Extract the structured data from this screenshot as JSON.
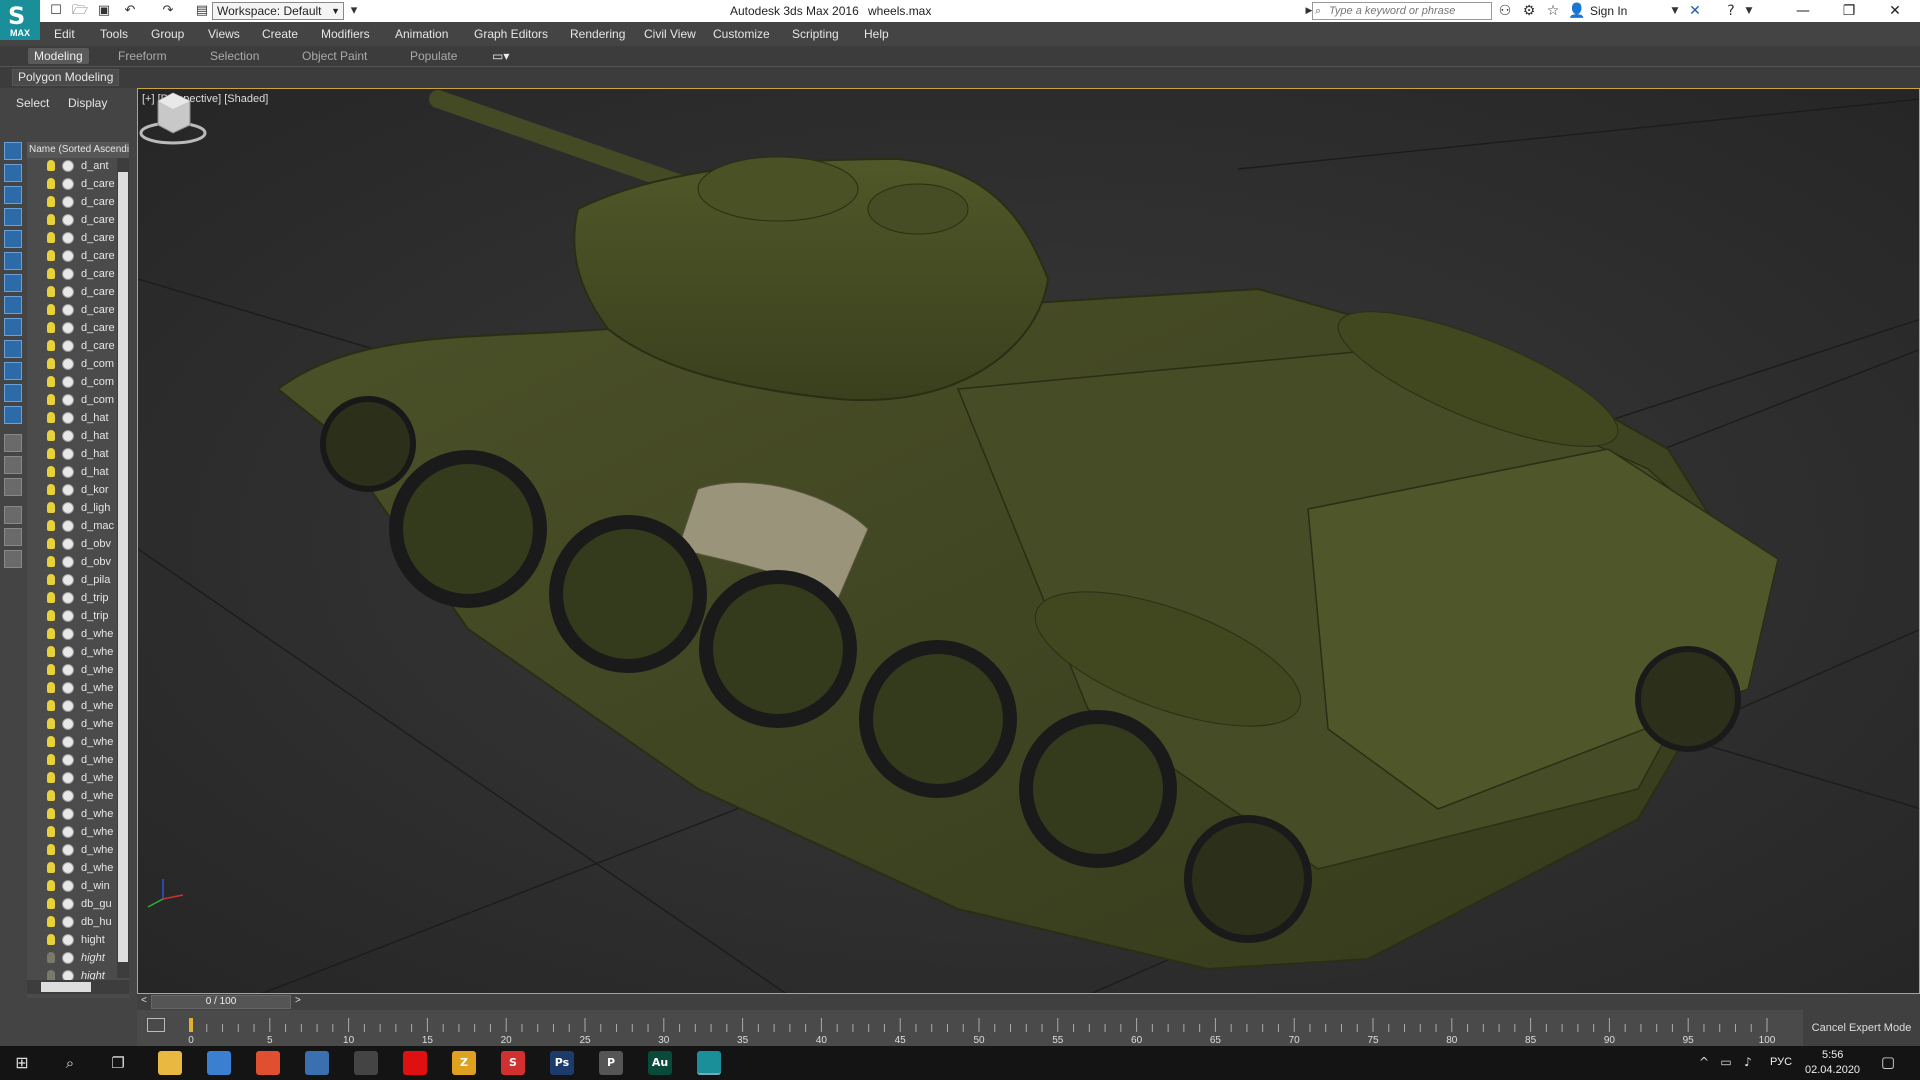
{
  "titlebar": {
    "app_badge": "MAX",
    "workspace": "Workspace: Default",
    "app_title": "Autodesk 3ds Max 2016",
    "file_name": "wheels.max",
    "search_placeholder": "Type a keyword or phrase",
    "sign_in": "Sign In"
  },
  "menu": [
    "Edit",
    "Tools",
    "Group",
    "Views",
    "Create",
    "Modifiers",
    "Animation",
    "Graph Editors",
    "Rendering",
    "Civil View",
    "Customize",
    "Scripting",
    "Help"
  ],
  "ribbon": {
    "tabs": [
      "Modeling",
      "Freeform",
      "Selection",
      "Object Paint",
      "Populate"
    ],
    "active_tab": "Modeling",
    "panel_label": "Polygon Modeling"
  },
  "scene_explorer": {
    "tabs": [
      "Select",
      "Display"
    ],
    "column_header": "Name (Sorted Ascending)",
    "items": [
      {
        "name": "d_ant",
        "on": true,
        "italic": false
      },
      {
        "name": "d_care",
        "on": true,
        "italic": false
      },
      {
        "name": "d_care",
        "on": true,
        "italic": false
      },
      {
        "name": "d_care",
        "on": true,
        "italic": false
      },
      {
        "name": "d_care",
        "on": true,
        "italic": false
      },
      {
        "name": "d_care",
        "on": true,
        "italic": false
      },
      {
        "name": "d_care",
        "on": true,
        "italic": false
      },
      {
        "name": "d_care",
        "on": true,
        "italic": false
      },
      {
        "name": "d_care",
        "on": true,
        "italic": false
      },
      {
        "name": "d_care",
        "on": true,
        "italic": false
      },
      {
        "name": "d_care",
        "on": true,
        "italic": false
      },
      {
        "name": "d_com",
        "on": true,
        "italic": false
      },
      {
        "name": "d_com",
        "on": true,
        "italic": false
      },
      {
        "name": "d_com",
        "on": true,
        "italic": false
      },
      {
        "name": "d_hat",
        "on": true,
        "italic": false
      },
      {
        "name": "d_hat",
        "on": true,
        "italic": false
      },
      {
        "name": "d_hat",
        "on": true,
        "italic": false
      },
      {
        "name": "d_hat",
        "on": true,
        "italic": false
      },
      {
        "name": "d_kor",
        "on": true,
        "italic": false
      },
      {
        "name": "d_ligh",
        "on": true,
        "italic": false
      },
      {
        "name": "d_mac",
        "on": true,
        "italic": false
      },
      {
        "name": "d_obv",
        "on": true,
        "italic": false
      },
      {
        "name": "d_obv",
        "on": true,
        "italic": false
      },
      {
        "name": "d_pila",
        "on": true,
        "italic": false
      },
      {
        "name": "d_trip",
        "on": true,
        "italic": false
      },
      {
        "name": "d_trip",
        "on": true,
        "italic": false
      },
      {
        "name": "d_whe",
        "on": true,
        "italic": false
      },
      {
        "name": "d_whe",
        "on": true,
        "italic": false
      },
      {
        "name": "d_whe",
        "on": true,
        "italic": false
      },
      {
        "name": "d_whe",
        "on": true,
        "italic": false
      },
      {
        "name": "d_whe",
        "on": true,
        "italic": false
      },
      {
        "name": "d_whe",
        "on": true,
        "italic": false
      },
      {
        "name": "d_whe",
        "on": true,
        "italic": false
      },
      {
        "name": "d_whe",
        "on": true,
        "italic": false
      },
      {
        "name": "d_whe",
        "on": true,
        "italic": false
      },
      {
        "name": "d_whe",
        "on": true,
        "italic": false
      },
      {
        "name": "d_whe",
        "on": true,
        "italic": false
      },
      {
        "name": "d_whe",
        "on": true,
        "italic": false
      },
      {
        "name": "d_whe",
        "on": true,
        "italic": false
      },
      {
        "name": "d_whe",
        "on": true,
        "italic": false
      },
      {
        "name": "d_win",
        "on": true,
        "italic": false
      },
      {
        "name": "db_gu",
        "on": true,
        "italic": false
      },
      {
        "name": "db_hu",
        "on": true,
        "italic": false
      },
      {
        "name": "hight",
        "on": true,
        "italic": false
      },
      {
        "name": "hight",
        "on": false,
        "italic": true
      },
      {
        "name": "hight",
        "on": false,
        "italic": true
      }
    ]
  },
  "viewport": {
    "label": "[+] [Perspective] [Shaded]",
    "border_color": "#c8a63c"
  },
  "timeline": {
    "frame": "0 / 100",
    "ticks": [
      "0",
      "5",
      "10",
      "15",
      "20",
      "25",
      "30",
      "35",
      "40",
      "45",
      "50",
      "55",
      "60",
      "65",
      "70",
      "75",
      "80",
      "85",
      "90",
      "95",
      "100"
    ],
    "cancel_expert": "Cancel Expert Mode"
  },
  "taskbar": {
    "apps": [
      {
        "label": "",
        "icon": "folder-icon",
        "color": "#e8b840"
      },
      {
        "label": "",
        "icon": "chrome-icon",
        "color": "#3a7fd0"
      },
      {
        "label": "",
        "icon": "paint-icon",
        "color": "#e05030"
      },
      {
        "label": "",
        "icon": "network-icon",
        "color": "#3a70b0"
      },
      {
        "label": "",
        "icon": "plane-icon",
        "color": "#444444"
      },
      {
        "label": "",
        "icon": "record-icon",
        "color": "#e01010"
      },
      {
        "label": "Z",
        "icon": "z-app-icon",
        "color": "#e0a020"
      },
      {
        "label": "S",
        "icon": "s-app-icon",
        "color": "#d03030"
      },
      {
        "label": "Ps",
        "icon": "photoshop-icon",
        "color": "#1c3a6a"
      },
      {
        "label": "P",
        "icon": "p-app-icon",
        "color": "#555555"
      },
      {
        "label": "Au",
        "icon": "audition-icon",
        "color": "#0a4a3a"
      },
      {
        "label": "",
        "icon": "3dsmax-icon",
        "color": "#1a8f9a"
      }
    ],
    "language": "РУС",
    "time": "5:56",
    "date": "02.04.2020"
  }
}
